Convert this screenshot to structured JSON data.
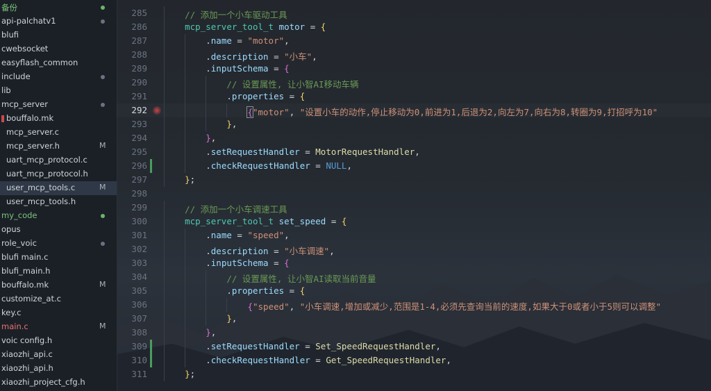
{
  "sidebar": {
    "items": [
      {
        "label": "备份",
        "indent": 0,
        "dot": "green",
        "color": "green"
      },
      {
        "label": "api-palchatv1",
        "indent": 0,
        "dot": "gray"
      },
      {
        "label": "blufi",
        "indent": 0
      },
      {
        "label": "cwebsocket",
        "indent": 0
      },
      {
        "label": "easyflash_common",
        "indent": 0
      },
      {
        "label": "include",
        "indent": 0,
        "dot": "gray"
      },
      {
        "label": "lib",
        "indent": 0
      },
      {
        "label": "mcp_server",
        "indent": 0,
        "dot": "gray"
      },
      {
        "label": "bouffalo.mk",
        "indent": 1,
        "icon": "makefile"
      },
      {
        "label": "mcp_server.c",
        "indent": 1
      },
      {
        "label": "mcp_server.h",
        "indent": 1,
        "badge": "M"
      },
      {
        "label": "uart_mcp_protocol.c",
        "indent": 1
      },
      {
        "label": "uart_mcp_protocol.h",
        "indent": 1
      },
      {
        "label": "user_mcp_tools.c",
        "indent": 1,
        "badge": "M",
        "selected": true
      },
      {
        "label": "user_mcp_tools.h",
        "indent": 1
      },
      {
        "label": "my_code",
        "indent": 0,
        "dot": "green",
        "color": "green"
      },
      {
        "label": "opus",
        "indent": 0
      },
      {
        "label": "role_voic",
        "indent": 0,
        "dot": "gray"
      },
      {
        "label": "blufi main.c",
        "indent": 0
      },
      {
        "label": "blufi_main.h",
        "indent": 0
      },
      {
        "label": "bouffalo.mk",
        "indent": 0,
        "badge": "M"
      },
      {
        "label": "customize_at.c",
        "indent": 0
      },
      {
        "label": "key.c",
        "indent": 0
      },
      {
        "label": "main.c",
        "indent": 0,
        "badge": "M",
        "color": "red"
      },
      {
        "label": "voic config.h",
        "indent": 0
      },
      {
        "label": "xiaozhi_api.c",
        "indent": 0
      },
      {
        "label": "xiaozhi_api.h",
        "indent": 0
      },
      {
        "label": "xiaozhi_project_cfg.h",
        "indent": 0
      }
    ]
  },
  "editor": {
    "current_line": "292",
    "lines": [
      {
        "n": "285",
        "indent": 1,
        "tokens": [
          [
            "cmt",
            "// 添加一个小车驱动工具"
          ]
        ]
      },
      {
        "n": "286",
        "indent": 1,
        "tokens": [
          [
            "typ",
            "mcp_server_tool_t"
          ],
          [
            "pun",
            " "
          ],
          [
            "var",
            "motor"
          ],
          [
            "pun",
            " = "
          ],
          [
            "brk",
            "{"
          ]
        ]
      },
      {
        "n": "287",
        "indent": 2,
        "tokens": [
          [
            "pun",
            "."
          ],
          [
            "var",
            "name"
          ],
          [
            "pun",
            " = "
          ],
          [
            "str",
            "\"motor\""
          ],
          [
            "pun",
            ","
          ]
        ]
      },
      {
        "n": "288",
        "indent": 2,
        "tokens": [
          [
            "pun",
            "."
          ],
          [
            "var",
            "description"
          ],
          [
            "pun",
            " = "
          ],
          [
            "str",
            "\"小车\""
          ],
          [
            "pun",
            ","
          ]
        ]
      },
      {
        "n": "289",
        "indent": 2,
        "tokens": [
          [
            "pun",
            "."
          ],
          [
            "var",
            "inputSchema"
          ],
          [
            "pun",
            " = "
          ],
          [
            "brk2",
            "{"
          ]
        ]
      },
      {
        "n": "290",
        "indent": 3,
        "tokens": [
          [
            "cmt",
            "// 设置属性, 让小智AI移动车辆"
          ]
        ]
      },
      {
        "n": "291",
        "indent": 3,
        "tokens": [
          [
            "pun",
            "."
          ],
          [
            "var",
            "properties"
          ],
          [
            "pun",
            " = "
          ],
          [
            "brk",
            "{"
          ]
        ]
      },
      {
        "n": "292",
        "indent": 4,
        "cursor": true,
        "tokens": [
          [
            "brk2",
            "{"
          ],
          [
            "str",
            "\"motor\""
          ],
          [
            "pun",
            ", "
          ],
          [
            "str",
            "\"设置小车的动作,停止移动为0,前进为1,后退为2,向左为7,向右为8,转圈为9,打招呼为10\""
          ]
        ]
      },
      {
        "n": "293",
        "indent": 3,
        "tokens": [
          [
            "brk",
            "}"
          ],
          [
            "pun",
            ","
          ]
        ]
      },
      {
        "n": "294",
        "indent": 2,
        "tokens": [
          [
            "brk2",
            "}"
          ],
          [
            "pun",
            ","
          ]
        ]
      },
      {
        "n": "295",
        "indent": 2,
        "tokens": [
          [
            "pun",
            "."
          ],
          [
            "var",
            "setRequestHandler"
          ],
          [
            "pun",
            " = "
          ],
          [
            "fn",
            "MotorRequestHandler"
          ],
          [
            "pun",
            ","
          ]
        ]
      },
      {
        "n": "296",
        "indent": 2,
        "tokens": [
          [
            "pun",
            "."
          ],
          [
            "var",
            "checkRequestHandler"
          ],
          [
            "pun",
            " = "
          ],
          [
            "kw",
            "NULL"
          ],
          [
            "pun",
            ","
          ]
        ]
      },
      {
        "n": "297",
        "indent": 1,
        "tokens": [
          [
            "brk",
            "}"
          ],
          [
            "pun",
            ";"
          ]
        ]
      },
      {
        "n": "298",
        "indent": 0,
        "tokens": []
      },
      {
        "n": "299",
        "indent": 1,
        "tokens": [
          [
            "cmt",
            "// 添加一个小车调速工具"
          ]
        ]
      },
      {
        "n": "300",
        "indent": 1,
        "tokens": [
          [
            "typ",
            "mcp_server_tool_t"
          ],
          [
            "pun",
            " "
          ],
          [
            "var",
            "set_speed"
          ],
          [
            "pun",
            " = "
          ],
          [
            "brk",
            "{"
          ]
        ]
      },
      {
        "n": "301",
        "indent": 2,
        "tokens": [
          [
            "pun",
            "."
          ],
          [
            "var",
            "name"
          ],
          [
            "pun",
            " = "
          ],
          [
            "str",
            "\"speed\""
          ],
          [
            "pun",
            ","
          ]
        ]
      },
      {
        "n": "302",
        "indent": 2,
        "tokens": [
          [
            "pun",
            "."
          ],
          [
            "var",
            "description"
          ],
          [
            "pun",
            " = "
          ],
          [
            "str",
            "\"小车调速\""
          ],
          [
            "pun",
            ","
          ]
        ]
      },
      {
        "n": "303",
        "indent": 2,
        "tokens": [
          [
            "pun",
            "."
          ],
          [
            "var",
            "inputSchema"
          ],
          [
            "pun",
            " = "
          ],
          [
            "brk2",
            "{"
          ]
        ]
      },
      {
        "n": "304",
        "indent": 3,
        "tokens": [
          [
            "cmt",
            "// 设置属性, 让小智AI读取当前音量"
          ]
        ]
      },
      {
        "n": "305",
        "indent": 3,
        "tokens": [
          [
            "pun",
            "."
          ],
          [
            "var",
            "properties"
          ],
          [
            "pun",
            " = "
          ],
          [
            "brk",
            "{"
          ]
        ]
      },
      {
        "n": "306",
        "indent": 4,
        "tokens": [
          [
            "brk2",
            "{"
          ],
          [
            "str",
            "\"speed\""
          ],
          [
            "pun",
            ", "
          ],
          [
            "str",
            "\"小车调速,增加或减少,范围是1-4,必须先查询当前的速度,如果大于0或者小于5则可以调整\""
          ]
        ]
      },
      {
        "n": "307",
        "indent": 3,
        "tokens": [
          [
            "brk",
            "}"
          ],
          [
            "pun",
            ","
          ]
        ]
      },
      {
        "n": "308",
        "indent": 2,
        "tokens": [
          [
            "brk2",
            "}"
          ],
          [
            "pun",
            ","
          ]
        ]
      },
      {
        "n": "309",
        "indent": 2,
        "tokens": [
          [
            "pun",
            "."
          ],
          [
            "var",
            "setRequestHandler"
          ],
          [
            "pun",
            " = "
          ],
          [
            "fn",
            "Set_SpeedRequestHandler"
          ],
          [
            "pun",
            ","
          ]
        ]
      },
      {
        "n": "310",
        "indent": 2,
        "tokens": [
          [
            "pun",
            "."
          ],
          [
            "var",
            "checkRequestHandler"
          ],
          [
            "pun",
            " = "
          ],
          [
            "fn",
            "Get_SpeedRequestHandler"
          ],
          [
            "pun",
            ","
          ]
        ]
      },
      {
        "n": "311",
        "indent": 1,
        "tokens": [
          [
            "brk",
            "}"
          ],
          [
            "pun",
            ";"
          ]
        ]
      }
    ],
    "changed_lines": [
      "296",
      "309",
      "310"
    ]
  }
}
